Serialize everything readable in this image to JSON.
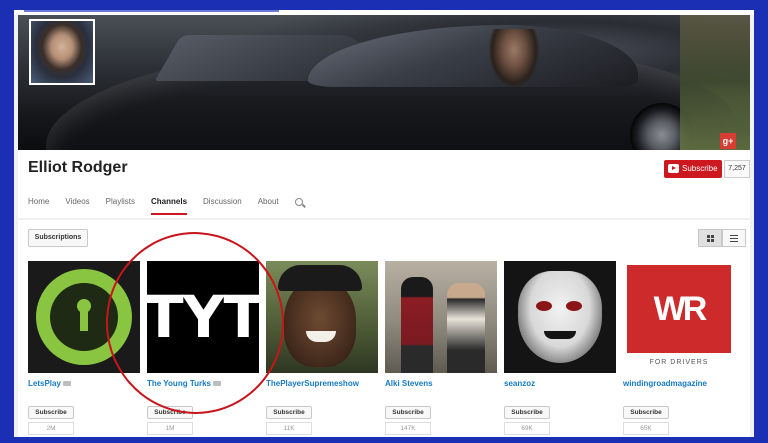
{
  "channel": {
    "title": "Elliot Rodger",
    "subscribe_label": "Subscribe",
    "subscriber_count": "7,257",
    "gplus_label": "g+"
  },
  "tabs": [
    {
      "label": "Home",
      "active": false
    },
    {
      "label": "Videos",
      "active": false
    },
    {
      "label": "Playlists",
      "active": false
    },
    {
      "label": "Channels",
      "active": true
    },
    {
      "label": "Discussion",
      "active": false
    },
    {
      "label": "About",
      "active": false
    }
  ],
  "content": {
    "subscriptions_label": "Subscriptions",
    "view_modes": [
      "grid-icon",
      "list-icon"
    ],
    "channels": [
      {
        "name": "LetsPlay",
        "verified": true,
        "subscribe_label": "Subscribe",
        "count": "2M"
      },
      {
        "name": "The Young Turks",
        "verified": true,
        "subscribe_label": "Subscribe",
        "count": "1M",
        "thumb_text": "TYT"
      },
      {
        "name": "ThePlayerSupremeshow",
        "verified": false,
        "subscribe_label": "Subscribe",
        "count": "11K"
      },
      {
        "name": "Alki Stevens",
        "verified": false,
        "subscribe_label": "Subscribe",
        "count": "147K"
      },
      {
        "name": "seanzoz",
        "verified": false,
        "subscribe_label": "Subscribe",
        "count": "69K"
      },
      {
        "name": "windingroadmagazine",
        "verified": false,
        "subscribe_label": "Subscribe",
        "count": "65K",
        "thumb_text": "WR",
        "thumb_subtext": "FOR DRIVERS"
      }
    ]
  },
  "colors": {
    "page_border": "#1a2fb4",
    "accent_red": "#cc181e",
    "link_blue": "#167ac6",
    "annotation_red": "#c8141a"
  }
}
